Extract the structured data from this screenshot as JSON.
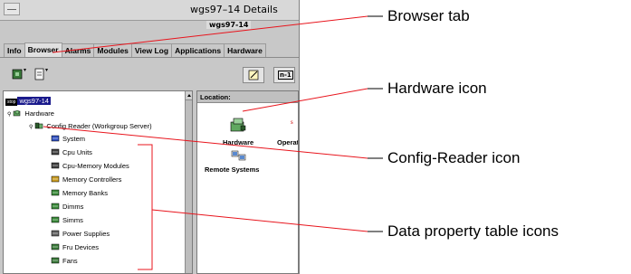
{
  "window": {
    "title": "wgs97–14 Details",
    "host_label": "wgs97-14"
  },
  "tabs": [
    {
      "label": "Info",
      "active": false
    },
    {
      "label": "Browser",
      "active": true
    },
    {
      "label": "Alarms",
      "active": false
    },
    {
      "label": "Modules",
      "active": false
    },
    {
      "label": "View Log",
      "active": false
    },
    {
      "label": "Applications",
      "active": false
    },
    {
      "label": "Hardware",
      "active": false
    }
  ],
  "toolbar": {
    "right_button_label": "n-1"
  },
  "tree": {
    "root": "wgs97-14",
    "root_badge": "stop",
    "hardware": "Hardware",
    "config_reader": "Config Reader (Workgroup Server)",
    "items": [
      {
        "label": "System",
        "icon": "system-icon"
      },
      {
        "label": "Cpu Units",
        "icon": "cpu-units-icon"
      },
      {
        "label": "Cpu-Memory Modules",
        "icon": "cpu-memory-modules-icon"
      },
      {
        "label": "Memory Controllers",
        "icon": "memory-controllers-icon"
      },
      {
        "label": "Memory Banks",
        "icon": "memory-banks-icon"
      },
      {
        "label": "Dimms",
        "icon": "dimms-icon"
      },
      {
        "label": "Simms",
        "icon": "simms-icon"
      },
      {
        "label": "Power Supplies",
        "icon": "power-supplies-icon"
      },
      {
        "label": "Fru Devices",
        "icon": "fru-devices-icon"
      },
      {
        "label": "Fans",
        "icon": "fans-icon"
      }
    ]
  },
  "right_pane": {
    "location_label": "Location:",
    "icons": [
      {
        "label": "Hardware"
      },
      {
        "label": "Operat"
      },
      {
        "label": "Remote Systems"
      }
    ]
  },
  "callouts": {
    "browser_tab": "Browser tab",
    "hardware_icon": "Hardware icon",
    "config_reader_icon": "Config-Reader icon",
    "data_property_table_icons": "Data property table icons"
  },
  "colors": {
    "selection": "#1a1a8c",
    "callout_line": "#e8141c",
    "window_bg": "#c8c8c8"
  }
}
